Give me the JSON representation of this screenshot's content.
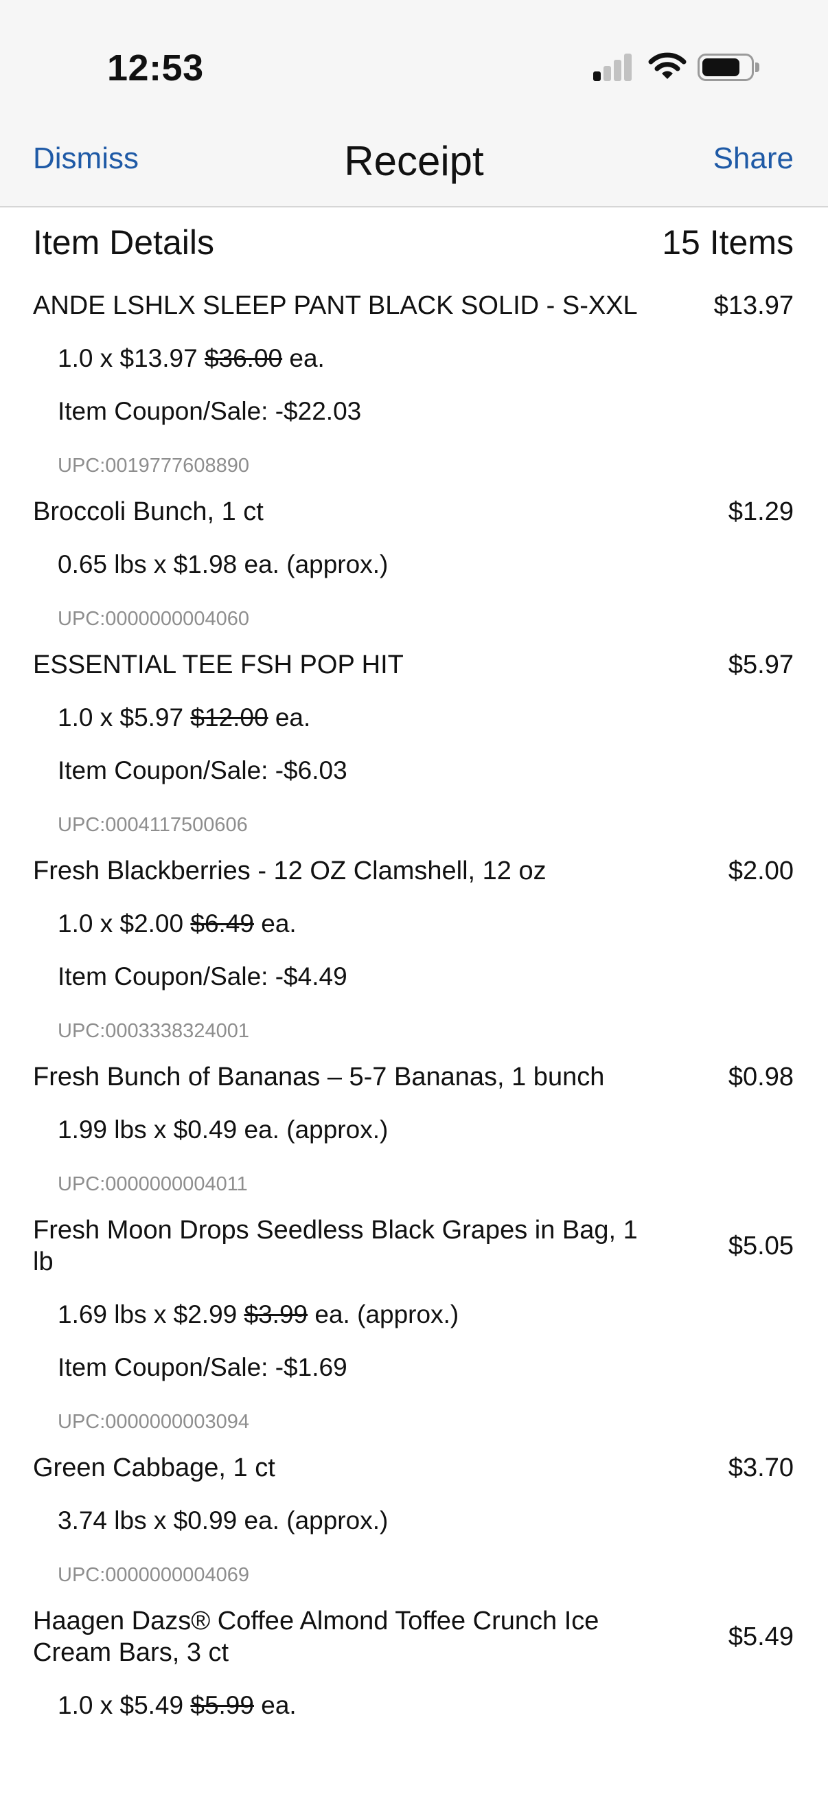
{
  "status_bar": {
    "time": "12:53",
    "signal_bars": 1,
    "battery_level": 0.8
  },
  "nav": {
    "left": "Dismiss",
    "title": "Receipt",
    "right": "Share",
    "link_color": "#1f5aa6"
  },
  "section": {
    "title": "Item Details",
    "count": "15 Items"
  },
  "items": [
    {
      "name": "ANDE LSHLX SLEEP PANT BLACK SOLID - S-XXL",
      "price": "$13.97",
      "qty_line": "1.0 x $13.97",
      "original": "$36.00",
      "unit_suffix": "ea.",
      "coupon": "Item Coupon/Sale: -$22.03",
      "upc": "UPC:0019777608890"
    },
    {
      "name": "Broccoli Bunch, 1 ct",
      "price": "$1.29",
      "qty_line": "0.65 lbs x $1.98",
      "original": "",
      "unit_suffix": "ea. (approx.)",
      "coupon": "",
      "upc": "UPC:0000000004060"
    },
    {
      "name": "ESSENTIAL TEE  FSH POP HIT",
      "price": "$5.97",
      "qty_line": "1.0 x $5.97",
      "original": "$12.00",
      "unit_suffix": "ea.",
      "coupon": "Item Coupon/Sale: -$6.03",
      "upc": "UPC:0004117500606"
    },
    {
      "name": "Fresh Blackberries - 12 OZ Clamshell, 12 oz",
      "price": "$2.00",
      "qty_line": "1.0 x $2.00",
      "original": "$6.49",
      "unit_suffix": "ea.",
      "coupon": "Item Coupon/Sale: -$4.49",
      "upc": "UPC:0003338324001"
    },
    {
      "name": "Fresh Bunch of Bananas – 5-7 Bananas, 1 bunch",
      "price": "$0.98",
      "qty_line": "1.99 lbs x $0.49",
      "original": "",
      "unit_suffix": "ea. (approx.)",
      "coupon": "",
      "upc": "UPC:0000000004011"
    },
    {
      "name": "Fresh Moon Drops Seedless Black Grapes in Bag, 1 lb",
      "price": "$5.05",
      "qty_line": "1.69 lbs x $2.99",
      "original": "$3.99",
      "unit_suffix": "ea. (approx.)",
      "coupon": "Item Coupon/Sale: -$1.69",
      "upc": "UPC:0000000003094"
    },
    {
      "name": "Green Cabbage, 1 ct",
      "price": "$3.70",
      "qty_line": "3.74 lbs x $0.99",
      "original": "",
      "unit_suffix": "ea. (approx.)",
      "coupon": "",
      "upc": "UPC:0000000004069"
    },
    {
      "name": "Haagen Dazs® Coffee Almond Toffee Crunch Ice Cream Bars, 3 ct",
      "price": "$5.49",
      "qty_line": "1.0 x $5.49",
      "original": "$5.99",
      "unit_suffix": "ea.",
      "coupon": "",
      "upc": ""
    }
  ]
}
